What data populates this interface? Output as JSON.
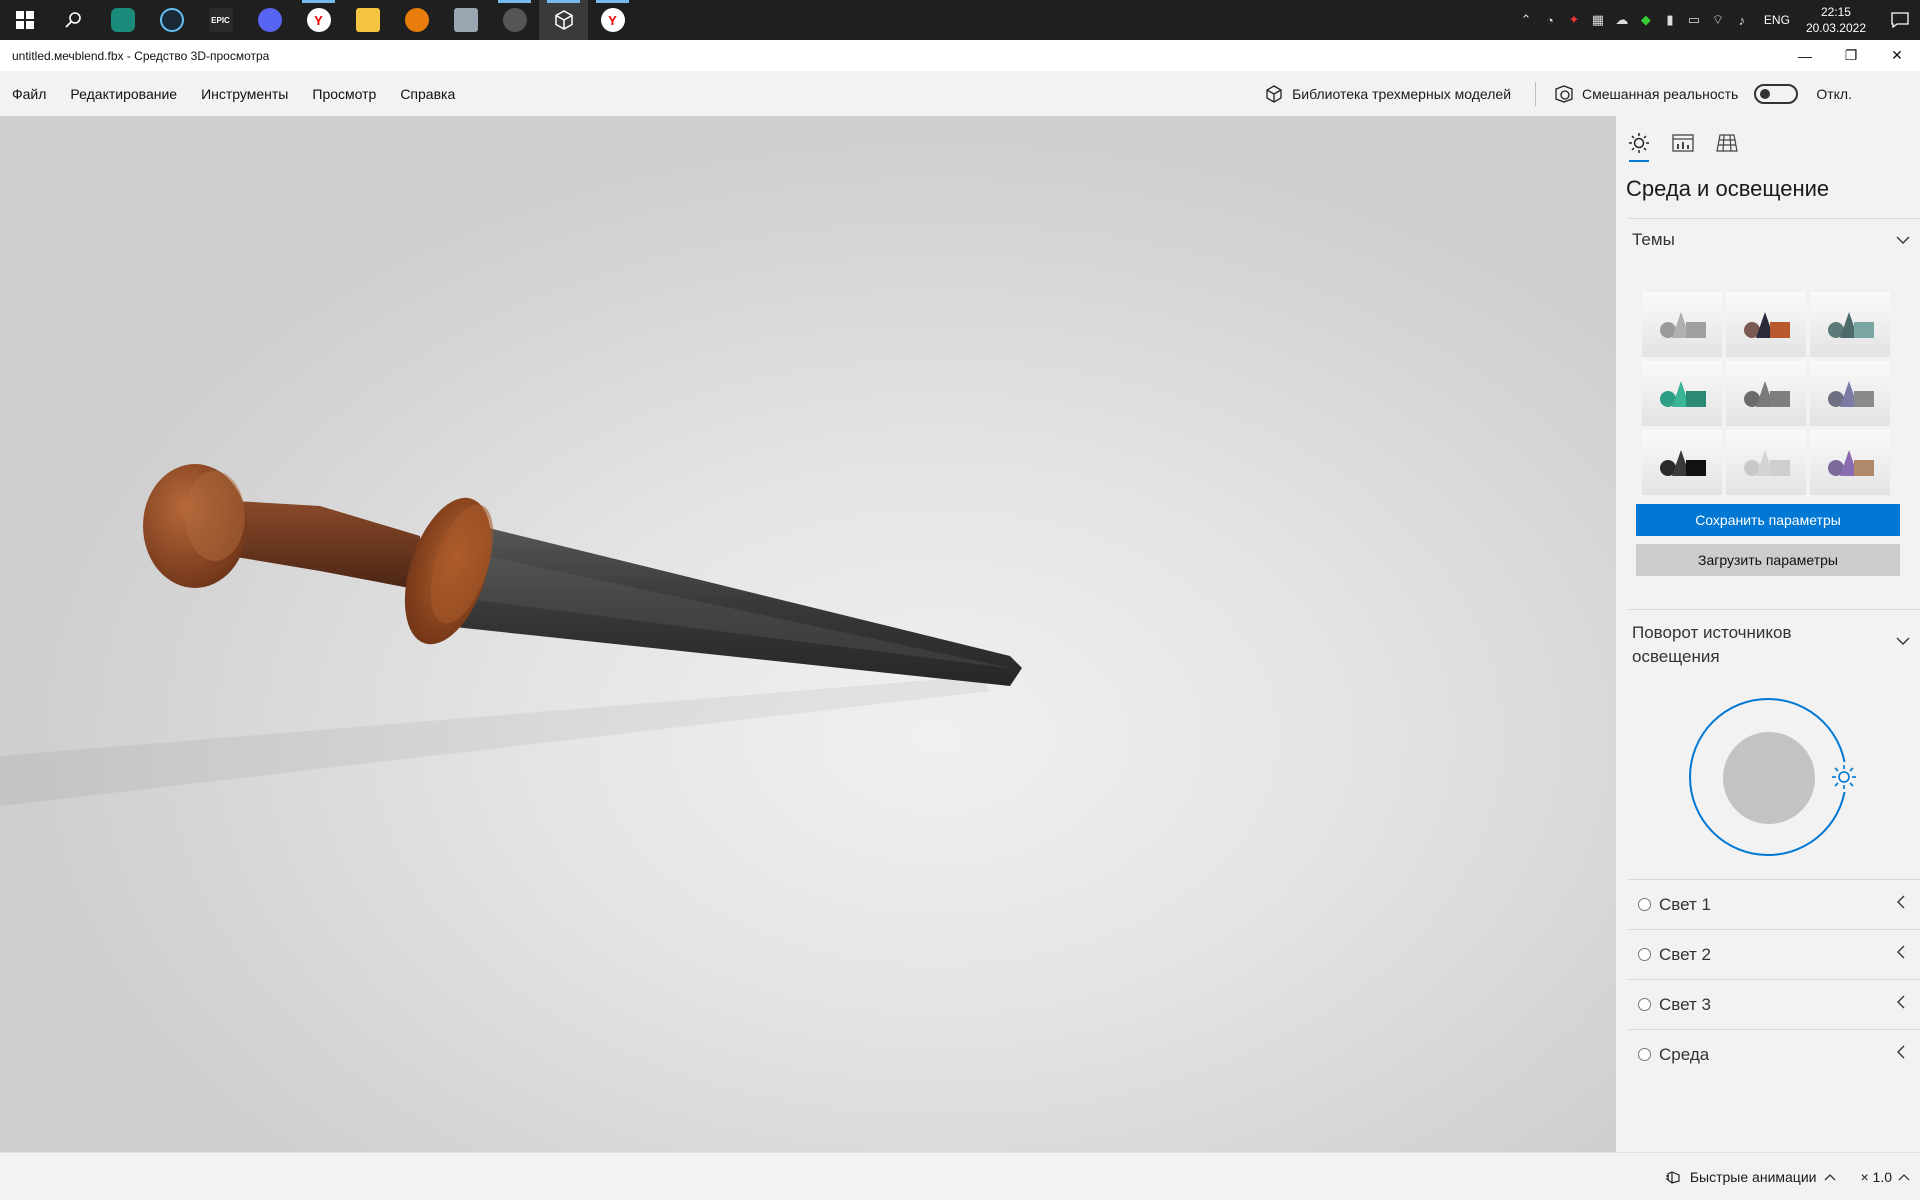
{
  "taskbar": {
    "icons": [
      "windows-start",
      "search",
      "app-shield",
      "steam",
      "epic-games",
      "discord",
      "yandex-browser",
      "file-explorer",
      "blender",
      "photos",
      "settings",
      "3d-viewer",
      "yandex-browser-2"
    ],
    "epic_label": "EPIC",
    "yandex_label": "Y",
    "lang": "ENG",
    "time": "22:15",
    "date": "20.03.2022"
  },
  "window": {
    "title": "untitled.мечblend.fbx - Средство 3D-просмотра"
  },
  "menu": {
    "items": [
      "Файл",
      "Редактирование",
      "Инструменты",
      "Просмотр",
      "Справка"
    ],
    "library_label": "Библиотека трехмерных моделей",
    "mixed_reality_label": "Смешанная реальность",
    "toggle_state": "Откл."
  },
  "panel": {
    "title": "Среда и освещение",
    "themes_label": "Темы",
    "themes": [
      {
        "sphere": "#9a9a9a",
        "cone": "#b0b0b0",
        "cube": "#a0a0a0"
      },
      {
        "sphere": "#7a5a50",
        "cone": "#2a2a3a",
        "cube": "#b8582c"
      },
      {
        "sphere": "#5c7a78",
        "cone": "#4e6a6a",
        "cube": "#7aa6a2"
      },
      {
        "sphere": "#2f9e86",
        "cone": "#3bb597",
        "cube": "#2a8a74"
      },
      {
        "sphere": "#6b6b6b",
        "cone": "#7a7a7a",
        "cube": "#7e7e7e"
      },
      {
        "sphere": "#6f6f82",
        "cone": "#7b7ba6",
        "cube": "#8a8a8a"
      },
      {
        "sphere": "#2a2a2a",
        "cone": "#3a3a3a",
        "cube": "#111111"
      },
      {
        "sphere": "#c8c8c8",
        "cone": "#d4d4d4",
        "cube": "#cfcfcf"
      },
      {
        "sphere": "#7a6a9a",
        "cone": "#8a6ab0",
        "cube": "#b0896a"
      }
    ],
    "save_label": "Сохранить параметры",
    "load_label": "Загрузить параметры",
    "rotation_label": "Поворот источников освещения",
    "lights": [
      "Свет 1",
      "Свет 2",
      "Свет 3",
      "Среда"
    ]
  },
  "status": {
    "animations_label": "Быстрые анимации",
    "speed_label": "× 1.0"
  },
  "colors": {
    "accent": "#0078d4",
    "taskbar": "#1f1f1f"
  }
}
